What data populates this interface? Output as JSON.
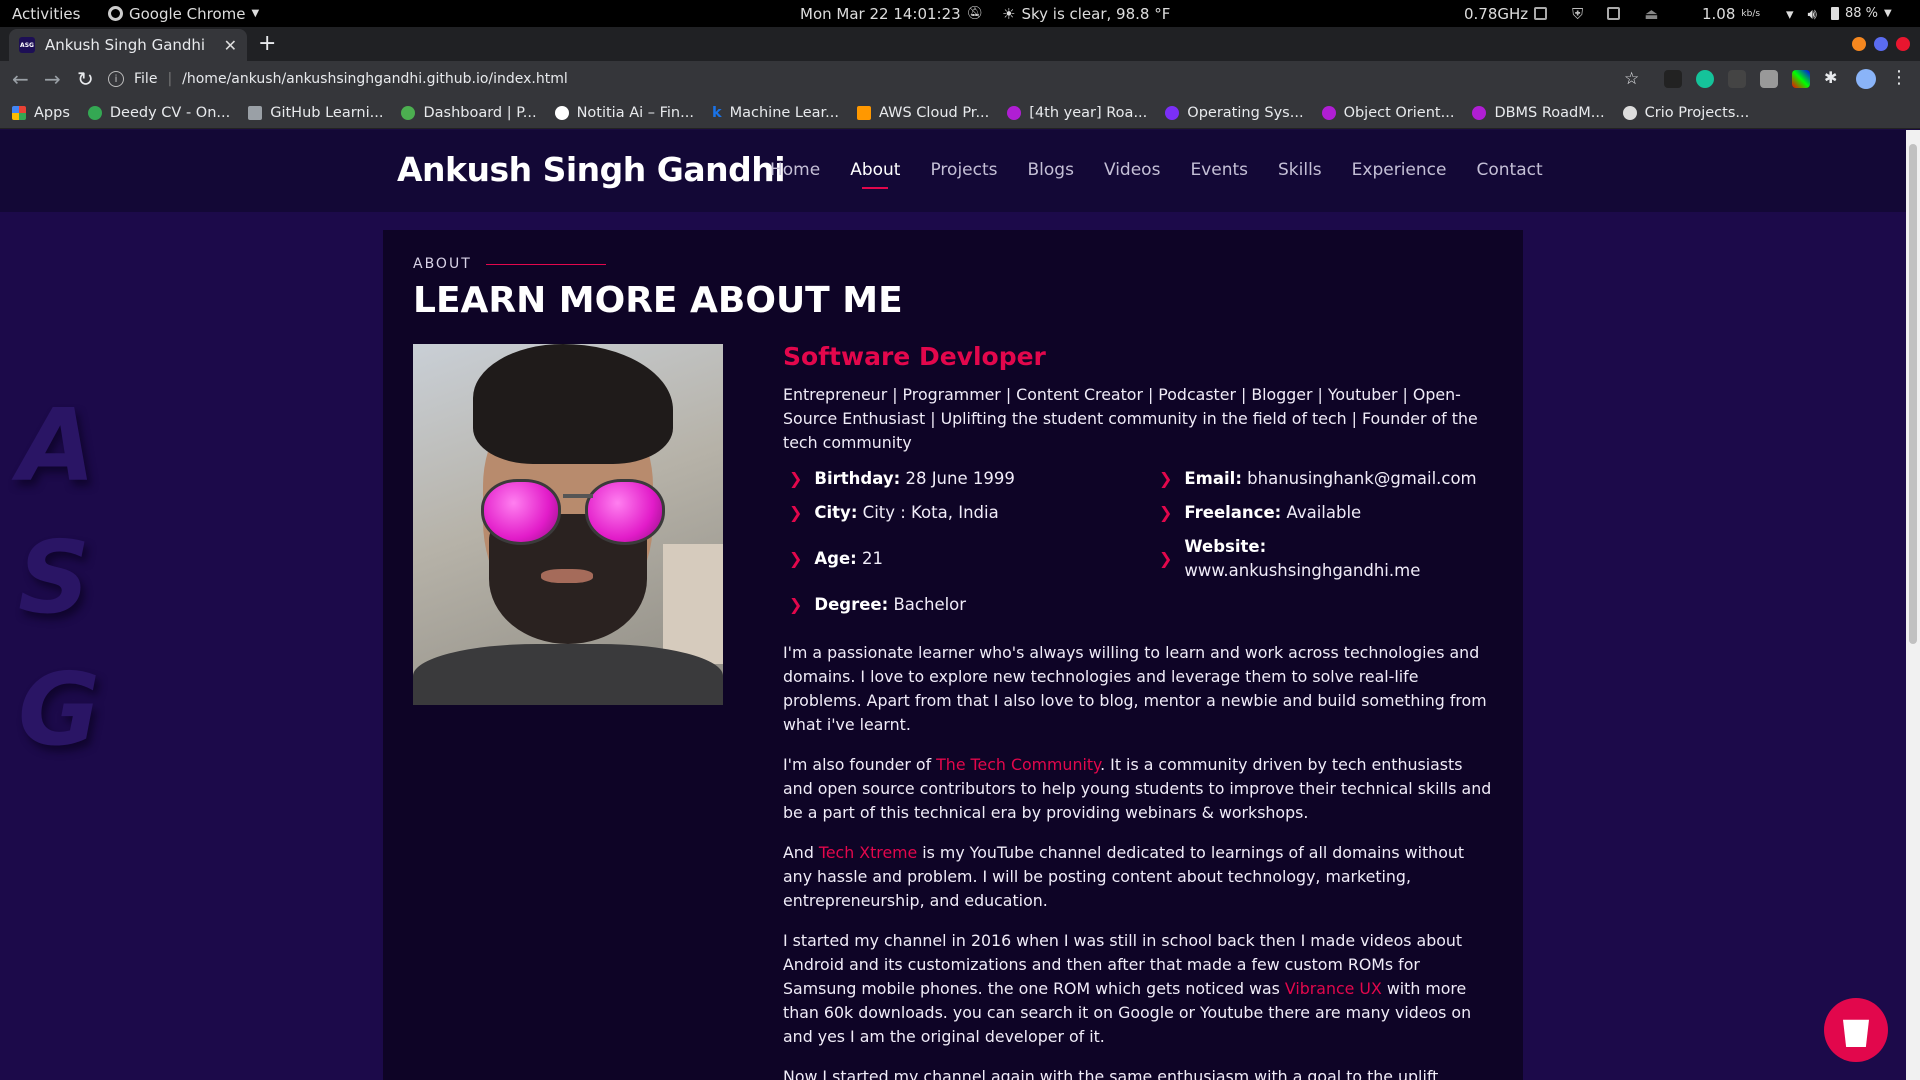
{
  "system_bar": {
    "activities": "Activities",
    "app_name": "Google Chrome",
    "datetime": "Mon Mar 22  14:01:23",
    "weather": "Sky is clear, 98.8 °F",
    "cpu": "0.78GHz",
    "net_speed": "1.08",
    "net_unit": "kb/s",
    "battery": "88 %"
  },
  "browser": {
    "tab_title": "Ankush Singh Gandhi",
    "favicon_text": "ASG",
    "url_scheme": "File",
    "url": "/home/ankush/ankushsinghgandhi.github.io/index.html",
    "bookmarks": [
      {
        "label": "Apps",
        "color": "#e94235"
      },
      {
        "label": "Deedy CV - On...",
        "color": "#34a853"
      },
      {
        "label": "GitHub Learni...",
        "color": "#9aa0a6"
      },
      {
        "label": "Dashboard | P...",
        "color": "#4caf50"
      },
      {
        "label": "Notitia Ai – Fin...",
        "color": "#ffffff"
      },
      {
        "label": "Machine Lear...",
        "color": "#1a73e8"
      },
      {
        "label": "AWS Cloud Pr...",
        "color": "#ff9800"
      },
      {
        "label": "[4th year] Roa...",
        "color": "#b01ed4"
      },
      {
        "label": "Operating Sys...",
        "color": "#7b2ff7"
      },
      {
        "label": "Object Orient...",
        "color": "#b01ed4"
      },
      {
        "label": "DBMS RoadM...",
        "color": "#b01ed4"
      },
      {
        "label": "Crio Projects...",
        "color": "#dddddd"
      }
    ]
  },
  "site": {
    "brand": "Ankush Singh Gandhi",
    "nav": [
      "Home",
      "About",
      "Projects",
      "Blogs",
      "Videos",
      "Events",
      "Skills",
      "Experience",
      "Contact"
    ],
    "active_nav": "About",
    "side_letters": [
      "A",
      "S",
      "G"
    ],
    "accent_color": "#e2074c"
  },
  "about": {
    "section_label": "ABOUT",
    "title": "LEARN MORE ABOUT ME",
    "role": "Software Devloper",
    "tagline": "Entrepreneur | Programmer | Content Creator | Podcaster | Blogger | Youtuber | Open-Source Enthusiast | Uplifting the student community in the field of tech | Founder of the tech community",
    "facts": [
      {
        "label": "Birthday:",
        "value": "28 June 1999"
      },
      {
        "label": "Email:",
        "value": "bhanusinghank@gmail.com"
      },
      {
        "label": "City:",
        "value": "City : Kota, India"
      },
      {
        "label": "Freelance:",
        "value": "Available"
      },
      {
        "label": "Age:",
        "value": "21"
      },
      {
        "label": "Website:",
        "value": "www.ankushsinghgandhi.me"
      },
      {
        "label": "Degree:",
        "value": "Bachelor"
      }
    ],
    "para1": "I'm a passionate learner who's always willing to learn and work across technologies and domains. I love to explore new technologies and leverage them to solve real-life problems. Apart from that I also love to blog, mentor a newbie and build something from what i've learnt.",
    "para2_pre": "I'm also founder of ",
    "para2_link": "The Tech Community",
    "para2_post": ". It is a community driven by tech enthusiasts and open source contributors to help young students to improve their technical skills and be a part of this technical era by providing webinars & workshops.",
    "para3_pre": "And ",
    "para3_link": "Tech Xtreme",
    "para3_post": " is my YouTube channel dedicated to learnings of all domains without any hassle and problem. I will be posting content about technology, marketing, entrepreneurship, and education.",
    "para4_pre": "I started my channel in 2016 when I was still in school back then I made videos about Android and its customizations and then after that made a few custom ROMs for Samsung mobile phones. the one ROM which gets noticed was ",
    "para4_link": "Vibrance UX",
    "para4_post": " with more than 60k downloads. you can search it on Google or Youtube there are many videos on and yes I am the original developer of it.",
    "para5": "Now I started my channel again with the same enthusiasm with a goal to the uplift community by providing free webinars, hands-on sessions, etc"
  }
}
